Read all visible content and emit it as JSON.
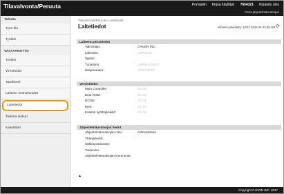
{
  "header": {
    "brand": "Tilavalvonta/Peruuta",
    "portal_link": "Portaaliin",
    "user_label": "Kirjaa käyttäjä:",
    "user_id": "7654321",
    "logout": "Kirjaudu ulos",
    "change_password": "Posta järjestelmänvalvojan"
  },
  "sidebar": {
    "section_status": "Tulosta",
    "items_status": [
      {
        "label": "Työn tila"
      },
      {
        "label": "Työloki"
      }
    ],
    "section_device": "VASTAANOTTO",
    "items_device": [
      {
        "label": "Työloki"
      },
      {
        "label": "Virhetiedot"
      },
      {
        "label": "Tarvikkeet"
      },
      {
        "label": "Laitteen ominaisuudet"
      },
      {
        "label": "Laitetiedot"
      },
      {
        "label": "Tarkista laskuri"
      },
      {
        "label": "Kasettiloki"
      }
    ]
  },
  "main": {
    "breadcrumb": "Tilavalvonta/Peruuta: Laitetiedot",
    "title": "Laitetiedot",
    "updated": "Viimeksi päivitetty: 12/12 2015 04:23:20 AM",
    "sections": [
      {
        "title": "Laitteen perustiedot",
        "rows": [
          {
            "key": "Valmistaja:",
            "value": "CANON INC.",
            "blur": false
          },
          {
            "key": "Laitenimi:",
            "value": "LBP0123",
            "blur": true
          },
          {
            "key": "Sijainti:",
            "value": "",
            "blur": false
          },
          {
            "key": "Tuotenimi:",
            "value": "LBP0123/123",
            "blur": true
          },
          {
            "key": "Sarjanumero:",
            "value": "XXXX0000",
            "blur": true
          }
        ]
      },
      {
        "title": "Versiotiedot",
        "rows": [
          {
            "key": "Main Controller:",
            "value": "01.03",
            "blur": true
          },
          {
            "key": "Boot ROM:",
            "value": "01.03",
            "blur": true
          },
          {
            "key": "DCON:",
            "value": "01.01",
            "blur": true
          },
          {
            "key": "Kieli:",
            "value": "01.16",
            "blur": true
          },
          {
            "key": "Kasetin syöttöyksikkö:",
            "value": "01.00",
            "blur": true
          }
        ]
      },
      {
        "title": "Järjestelmänvalvojan tiedot",
        "rows": [
          {
            "key": "Järjestelmänvalvojan nimi:",
            "value": "Administrator",
            "blur": false
          },
          {
            "key": "Yhteystiedot:",
            "value": "",
            "blur": false
          },
          {
            "key": "Sähköpostiosoite:",
            "value": "",
            "blur": false
          },
          {
            "key": "Tiedonimi:",
            "value": "",
            "blur": false
          },
          {
            "key": "Järjestelmänvalvojan kommentti:",
            "value": "",
            "blur": false
          }
        ]
      }
    ],
    "to_top": "▲"
  },
  "footer": {
    "copyright": "Copyright CANON INC. 2017"
  }
}
